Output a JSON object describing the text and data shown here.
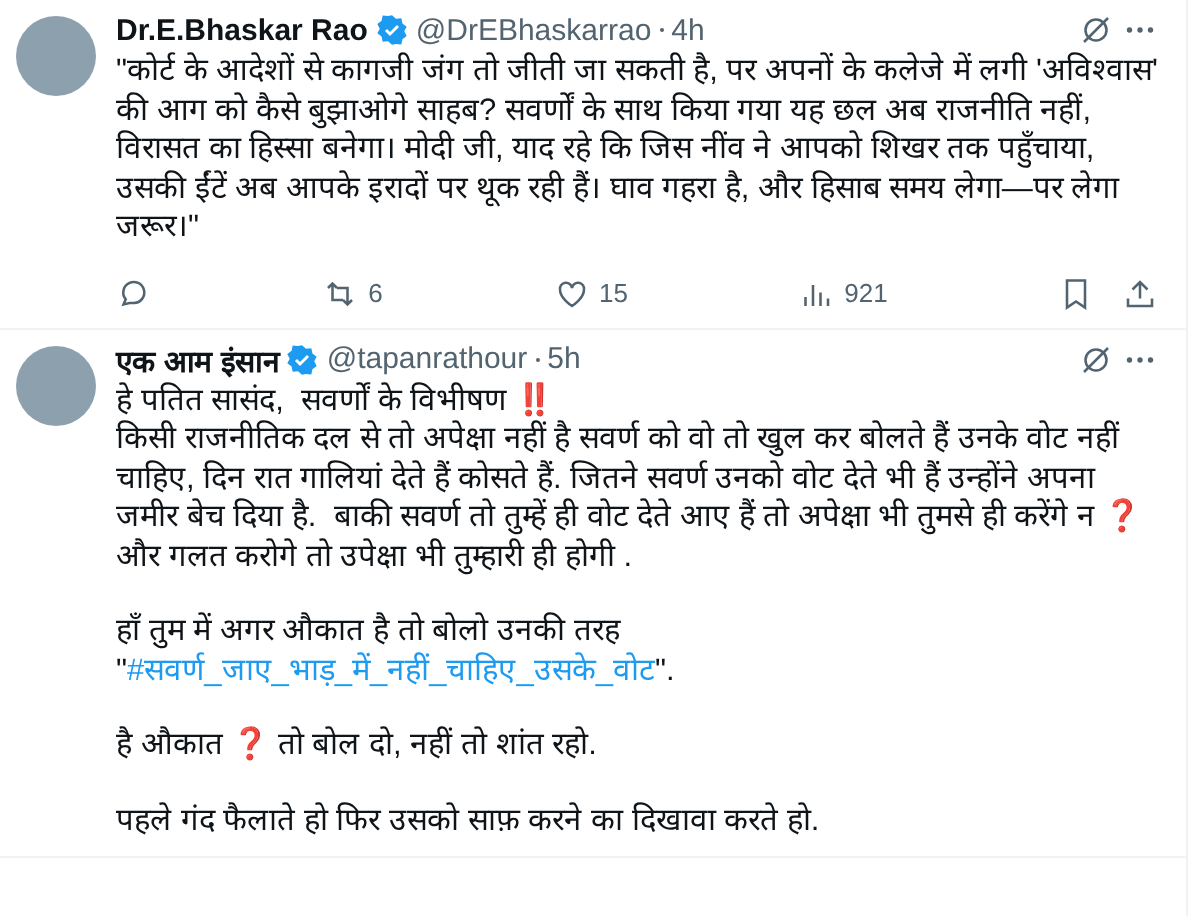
{
  "tweets": [
    {
      "name": "Dr.E.Bhaskar Rao",
      "handle": "@DrEBhaskarrao",
      "time": "4h",
      "paragraphs": [
        [
          [
            {
              "kind": "text",
              "text": "\"कोर्ट के आदेशों से कागजी जंग तो जीती जा सकती है, पर अपनों के कलेजे में लगी 'अविश्वास' की आग को कैसे बुझाओगे साहब? सवर्णों के साथ किया गया यह छल अब राजनीति नहीं, विरासत का हिस्सा बनेगा। मोदी जी, याद रहे कि जिस नींव ने आपको शिखर तक पहुँचाया, उसकी ईंटें अब आपके इरादों पर थूक रही हैं। घाव गहरा है, और हिसाब समय लेगा—पर लेगा जरूर।\""
            }
          ]
        ]
      ],
      "actions": {
        "reposts": "6",
        "likes": "15",
        "views": "921"
      }
    },
    {
      "name": "एक आम इंसान",
      "handle": "@tapanrathour",
      "time": "5h",
      "paragraphs": [
        [
          [
            {
              "kind": "text",
              "text": "हे पतित सासंद,  सवर्णों के विभीषण ‼️"
            }
          ],
          [
            {
              "kind": "text",
              "text": "किसी राजनीतिक दल से तो अपेक्षा नहीं है सवर्ण को वो तो खुल कर बोलते हैं उनके वोट नहीं चाहिए, दिन रात गालियां देते हैं कोसते हैं. जितने सवर्ण उनको वोट देते भी हैं उन्होंने अपना जमीर बेच दिया है.  बाकी सवर्ण तो तुम्हें ही वोट देते आए हैं तो अपेक्षा भी तुमसे ही करेंगे न ❓ और गलत करोगे तो उपेक्षा भी तुम्हारी ही होगी ."
            }
          ]
        ],
        [
          [
            {
              "kind": "text",
              "text": "हाँ तुम में अगर औकात है तो बोलो उनकी तरह"
            }
          ],
          [
            {
              "kind": "text",
              "text": "\""
            },
            {
              "kind": "link",
              "text": "#सवर्ण_जाए_भाड़_में_नहीं_चाहिए_उसके_वोट"
            },
            {
              "kind": "text",
              "text": "\"."
            }
          ]
        ],
        [
          [
            {
              "kind": "text",
              "text": "है औकात ❓ तो बोल दो, नहीं तो शांत रहो."
            }
          ]
        ],
        [
          [
            {
              "kind": "text",
              "text": "पहले गंद फैलाते हो फिर उसको साफ़ करने का दिखावा करते हो."
            }
          ]
        ]
      ]
    }
  ]
}
